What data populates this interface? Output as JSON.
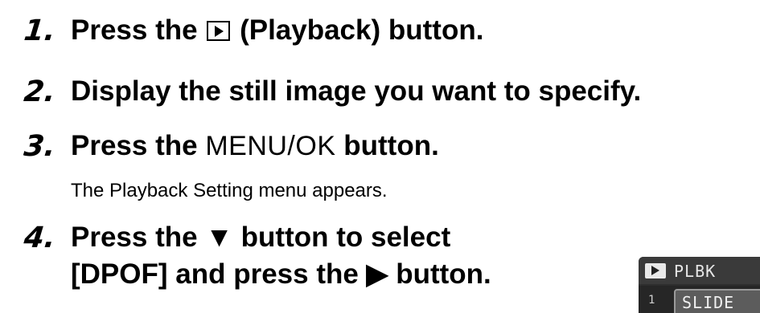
{
  "steps": [
    {
      "number": "1.",
      "pre": "Press the",
      "post": "(Playback) button."
    },
    {
      "number": "2.",
      "text": "Display the still image you want to specify."
    },
    {
      "number": "3.",
      "pre": "Press the",
      "button_name": "MENU/OK",
      "post": "button.",
      "sub": "The Playback Setting menu appears."
    },
    {
      "number": "4.",
      "line1": "Press the ▼ button to select",
      "line2": "[DPOF] and press the ▶ button."
    }
  ],
  "lcd": {
    "menu_label": "PLBK",
    "row_number": "1",
    "selected_item": "SLIDE"
  }
}
